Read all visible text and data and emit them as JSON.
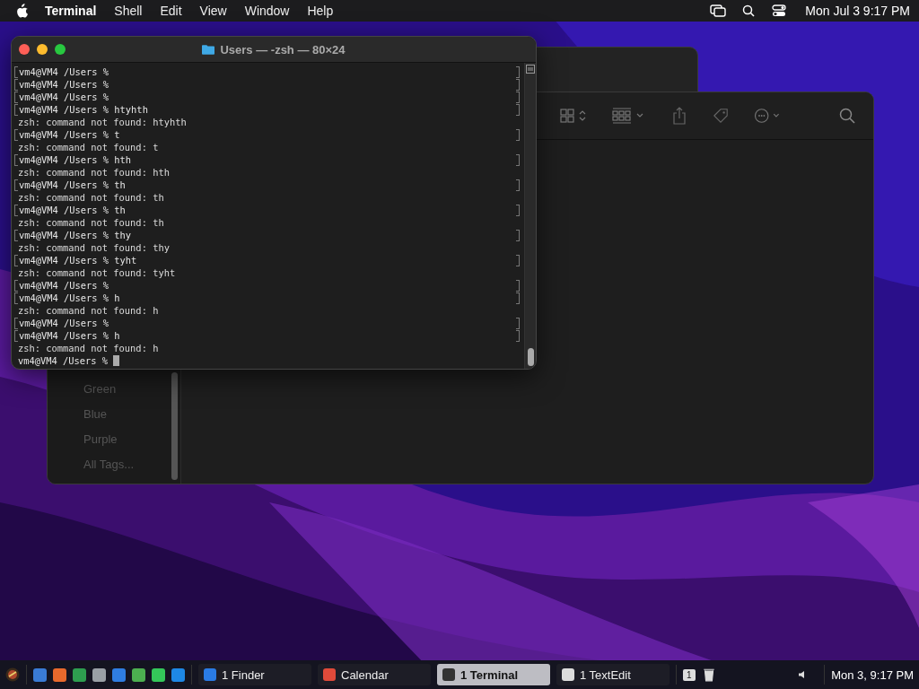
{
  "menu_bar": {
    "app": "Terminal",
    "items": [
      "Shell",
      "Edit",
      "View",
      "Window",
      "Help"
    ],
    "clock": "Mon Jul 3  9:17 PM"
  },
  "finder": {
    "sidebar": {
      "items": [
        "Green",
        "Blue",
        "Purple",
        "All Tags..."
      ]
    }
  },
  "terminal": {
    "title": "Users — -zsh — 80×24",
    "lines": [
      {
        "kind": "prompt",
        "text": "vm4@VM4 /Users % ",
        "marked": true,
        "cursor": false
      },
      {
        "kind": "prompt",
        "text": "vm4@VM4 /Users % ",
        "marked": true,
        "cursor": false
      },
      {
        "kind": "prompt",
        "text": "vm4@VM4 /Users % ",
        "marked": true,
        "cursor": false
      },
      {
        "kind": "prompt",
        "text": "vm4@VM4 /Users % htyhth",
        "marked": true,
        "cursor": false
      },
      {
        "kind": "output",
        "text": "zsh: command not found: htyhth",
        "marked": false,
        "cursor": false
      },
      {
        "kind": "prompt",
        "text": "vm4@VM4 /Users % t",
        "marked": true,
        "cursor": false
      },
      {
        "kind": "output",
        "text": "zsh: command not found: t",
        "marked": false,
        "cursor": false
      },
      {
        "kind": "prompt",
        "text": "vm4@VM4 /Users % hth",
        "marked": true,
        "cursor": false
      },
      {
        "kind": "output",
        "text": "zsh: command not found: hth",
        "marked": false,
        "cursor": false
      },
      {
        "kind": "prompt",
        "text": "vm4@VM4 /Users % th",
        "marked": true,
        "cursor": false
      },
      {
        "kind": "output",
        "text": "zsh: command not found: th",
        "marked": false,
        "cursor": false
      },
      {
        "kind": "prompt",
        "text": "vm4@VM4 /Users % th",
        "marked": true,
        "cursor": false
      },
      {
        "kind": "output",
        "text": "zsh: command not found: th",
        "marked": false,
        "cursor": false
      },
      {
        "kind": "prompt",
        "text": "vm4@VM4 /Users % thy",
        "marked": true,
        "cursor": false
      },
      {
        "kind": "output",
        "text": "zsh: command not found: thy",
        "marked": false,
        "cursor": false
      },
      {
        "kind": "prompt",
        "text": "vm4@VM4 /Users % tyht",
        "marked": true,
        "cursor": false
      },
      {
        "kind": "output",
        "text": "zsh: command not found: tyht",
        "marked": false,
        "cursor": false
      },
      {
        "kind": "prompt",
        "text": "vm4@VM4 /Users % ",
        "marked": true,
        "cursor": false
      },
      {
        "kind": "prompt",
        "text": "vm4@VM4 /Users % h",
        "marked": true,
        "cursor": false
      },
      {
        "kind": "output",
        "text": "zsh: command not found: h",
        "marked": false,
        "cursor": false
      },
      {
        "kind": "prompt",
        "text": "vm4@VM4 /Users % ",
        "marked": true,
        "cursor": false
      },
      {
        "kind": "prompt",
        "text": "vm4@VM4 /Users % h",
        "marked": true,
        "cursor": false
      },
      {
        "kind": "output",
        "text": "zsh: command not found: h",
        "marked": false,
        "cursor": false
      },
      {
        "kind": "prompt",
        "text": "vm4@VM4 /Users % ",
        "marked": false,
        "cursor": true
      }
    ]
  },
  "taskbar": {
    "tasks": [
      {
        "label": "1 Finder",
        "selected": false
      },
      {
        "label": "Calendar",
        "selected": false
      },
      {
        "label": "1 Terminal",
        "selected": true
      },
      {
        "label": "1 TextEdit",
        "selected": false
      }
    ],
    "workspace": "1",
    "clock": "Mon 3, 9:17 PM"
  }
}
